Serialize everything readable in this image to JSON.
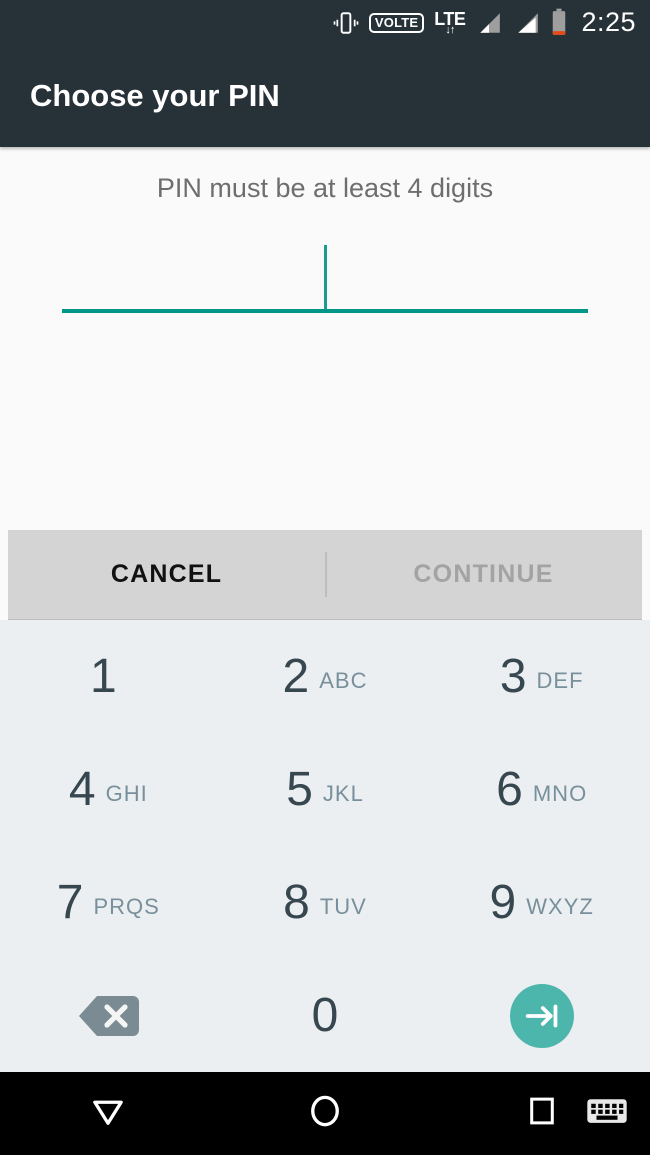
{
  "status_bar": {
    "vibrate_icon": "vibrate-icon",
    "volte_label": "VOLTE",
    "lte_label": "LTE",
    "lte_arrows": "↓↑",
    "signal_icon_1": "signal-bars-icon",
    "signal_icon_2": "signal-bars-icon",
    "battery_icon": "battery-low-icon",
    "time": "2:25"
  },
  "app_bar": {
    "title": "Choose your PIN"
  },
  "content": {
    "hint": "PIN must be at least 4 digits",
    "pin_value": "",
    "accent_color": "#009688",
    "caret_color": "#1C9C8E"
  },
  "actions": {
    "cancel_label": "CANCEL",
    "continue_label": "CONTINUE",
    "continue_enabled": false
  },
  "keypad": {
    "rows": [
      [
        {
          "digit": "1",
          "letters": ""
        },
        {
          "digit": "2",
          "letters": "ABC"
        },
        {
          "digit": "3",
          "letters": "DEF"
        }
      ],
      [
        {
          "digit": "4",
          "letters": "GHI"
        },
        {
          "digit": "5",
          "letters": "JKL"
        },
        {
          "digit": "6",
          "letters": "MNO"
        }
      ],
      [
        {
          "digit": "7",
          "letters": "PRQS"
        },
        {
          "digit": "8",
          "letters": "TUV"
        },
        {
          "digit": "9",
          "letters": "WXYZ"
        }
      ]
    ],
    "bottom_row": {
      "backspace_icon": "backspace-icon",
      "zero_digit": "0",
      "next_icon": "arrow-to-bar-next-icon",
      "next_color": "#4DB6AC"
    }
  },
  "nav_bar": {
    "back_icon": "dismiss-keyboard-down-triangle-icon",
    "home_icon": "home-circle-icon",
    "recents_icon": "recents-square-icon",
    "keyboard_icon": "keyboard-switch-icon"
  }
}
